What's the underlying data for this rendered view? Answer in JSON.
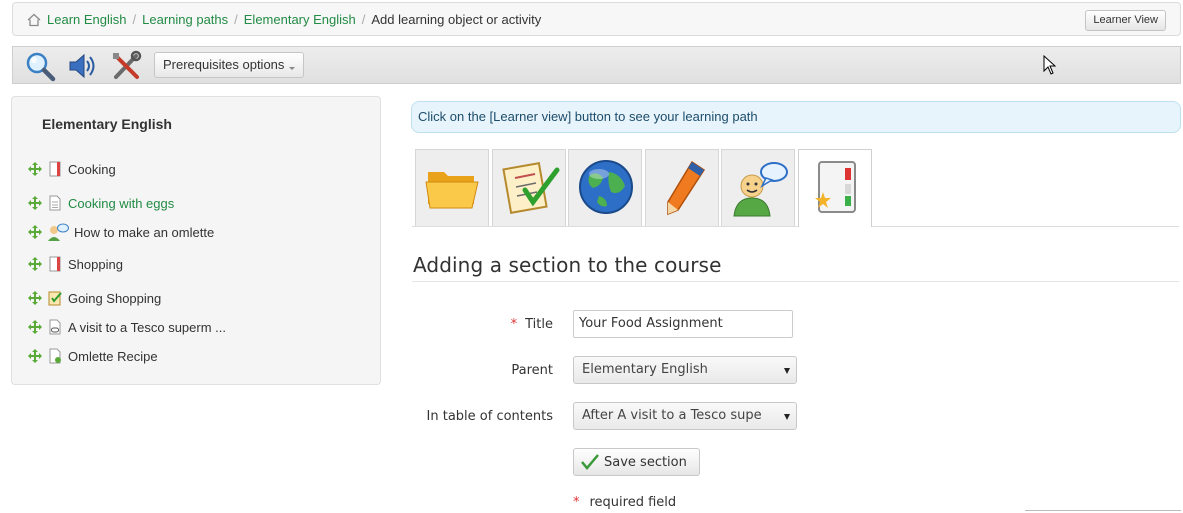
{
  "breadcrumb": {
    "home_icon": "home-icon",
    "items": [
      "Learn English",
      "Learning paths",
      "Elementary English"
    ],
    "current": "Add learning object or activity",
    "separator": "/"
  },
  "header": {
    "learner_view_label": "Learner View"
  },
  "toolbar": {
    "icons": [
      "magnifier-preview-icon",
      "speaker-audio-icon",
      "tools-settings-icon"
    ],
    "prerequisites_label": "Prerequisites options"
  },
  "sidebar": {
    "title": "Elementary English",
    "items": [
      {
        "label": "Cooking",
        "icon": "chapter-icon",
        "active": false
      },
      {
        "label": "Cooking with eggs",
        "icon": "document-icon",
        "active": true
      },
      {
        "label": "How to make an omlette",
        "icon": "forum-users-icon",
        "active": false
      },
      {
        "label": "Shopping",
        "icon": "chapter-icon",
        "active": false
      },
      {
        "label": "Going Shopping",
        "icon": "quiz-icon",
        "active": false
      },
      {
        "label": "A visit to a Tesco superm ...",
        "icon": "link-icon",
        "active": false
      },
      {
        "label": "Omlette Recipe",
        "icon": "file-icon",
        "active": false
      }
    ]
  },
  "info_message": "Click on the [Learner view] button to see your learning path",
  "tabs": [
    {
      "icon": "folder-icon",
      "active": false
    },
    {
      "icon": "quiz-checklist-icon",
      "active": false
    },
    {
      "icon": "globe-link-icon",
      "active": false
    },
    {
      "icon": "pencil-assignment-icon",
      "active": false
    },
    {
      "icon": "forum-chat-icon",
      "active": false
    },
    {
      "icon": "new-section-icon",
      "active": true
    }
  ],
  "form": {
    "heading": "Adding a section to the course",
    "title_label": "Title",
    "title_value": "Your Food Assignment",
    "parent_label": "Parent",
    "parent_value": "Elementary English",
    "toc_label": "In table of contents",
    "toc_value": "After A visit to a Tesco supe",
    "save_label": "Save section",
    "required_marker": "*",
    "required_note": "required field"
  },
  "colors": {
    "link": "#228b45",
    "required": "#dd3333",
    "info_bg": "#e8f4fb"
  }
}
